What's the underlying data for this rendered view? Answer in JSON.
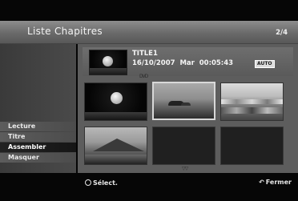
{
  "header": {
    "title": "Liste Chapitres",
    "pages": "2/4"
  },
  "info": {
    "title": "TITLE1",
    "datetime": "16/10/2007  Mar  00:05:43",
    "badge": "AUTO"
  },
  "scroll": {
    "up": "DVD",
    "down": "▽▽"
  },
  "menu": {
    "items": [
      {
        "label": "Lecture"
      },
      {
        "label": "Titre"
      },
      {
        "label": "Assembler"
      },
      {
        "label": "Masquer"
      }
    ],
    "active_index": 2
  },
  "thumbnails": [
    {
      "art": "moon-night-icon",
      "selected": false
    },
    {
      "art": "sea-rock-icon",
      "selected": true
    },
    {
      "art": "waves-icon",
      "selected": false
    },
    {
      "art": "mountain-lake-icon",
      "selected": false
    },
    {
      "art": "empty",
      "selected": false
    },
    {
      "art": "empty",
      "selected": false
    }
  ],
  "footer": {
    "select_label": "Sélect.",
    "close_label": "Fermer"
  },
  "colors": {
    "header": "#7a7a7a",
    "panel": "#5d5d5d",
    "background": "#060606",
    "selected_border": "#d8d8d8"
  }
}
